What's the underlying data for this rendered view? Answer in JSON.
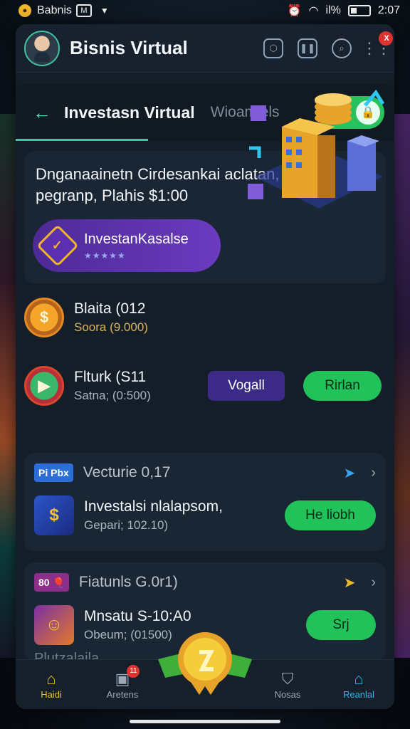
{
  "status": {
    "carrier": "Babnis",
    "app_box": "M",
    "signal_text": "il%",
    "time": "2:07"
  },
  "header": {
    "title": "Bisnis Virtual",
    "notif_badge": "X"
  },
  "tabs": {
    "active": "Investasn Virtual",
    "inactive": "Wioamiels"
  },
  "hero": {
    "text": "Dnganaainetn Cirdesankai aclatan, pegranp, Plahis $1:00",
    "pill_title": "InvestanKasalse",
    "pill_stars": "★★★★★"
  },
  "items": [
    {
      "title": "Blaita (012",
      "sub": "Soora (9.000)"
    },
    {
      "title": "Flturk (S11",
      "sub": "Satna; (0:500)",
      "button_left": "Vogall",
      "button_right": "Rirlan"
    }
  ],
  "sections": [
    {
      "tag": "Pi Pbx",
      "title": "Vecturie 0,17",
      "item_title": "Investalsi nlalapsom,",
      "item_sub": "Gepari; 102.10)",
      "button": "He liobh"
    },
    {
      "tag": "80 🎈",
      "title": "Fiatunls G.0r1)",
      "item_title": "Mnsatu S-10:A0",
      "item_sub": "Obeum; (01500)",
      "button": "Srj"
    }
  ],
  "partial_row": "Plutzalaila",
  "nav": [
    {
      "label": "Haidi",
      "icon": "home-icon"
    },
    {
      "label": "Aretens",
      "icon": "box-icon",
      "badge": "11"
    },
    {
      "label": "Nosas",
      "icon": "shield-icon"
    },
    {
      "label": "Reanlal",
      "icon": "home-outline-icon"
    }
  ],
  "colors": {
    "accent_green": "#22c25a",
    "accent_teal": "#36c9a2",
    "accent_purple": "#4d2a96",
    "gold": "#e7c22c"
  }
}
